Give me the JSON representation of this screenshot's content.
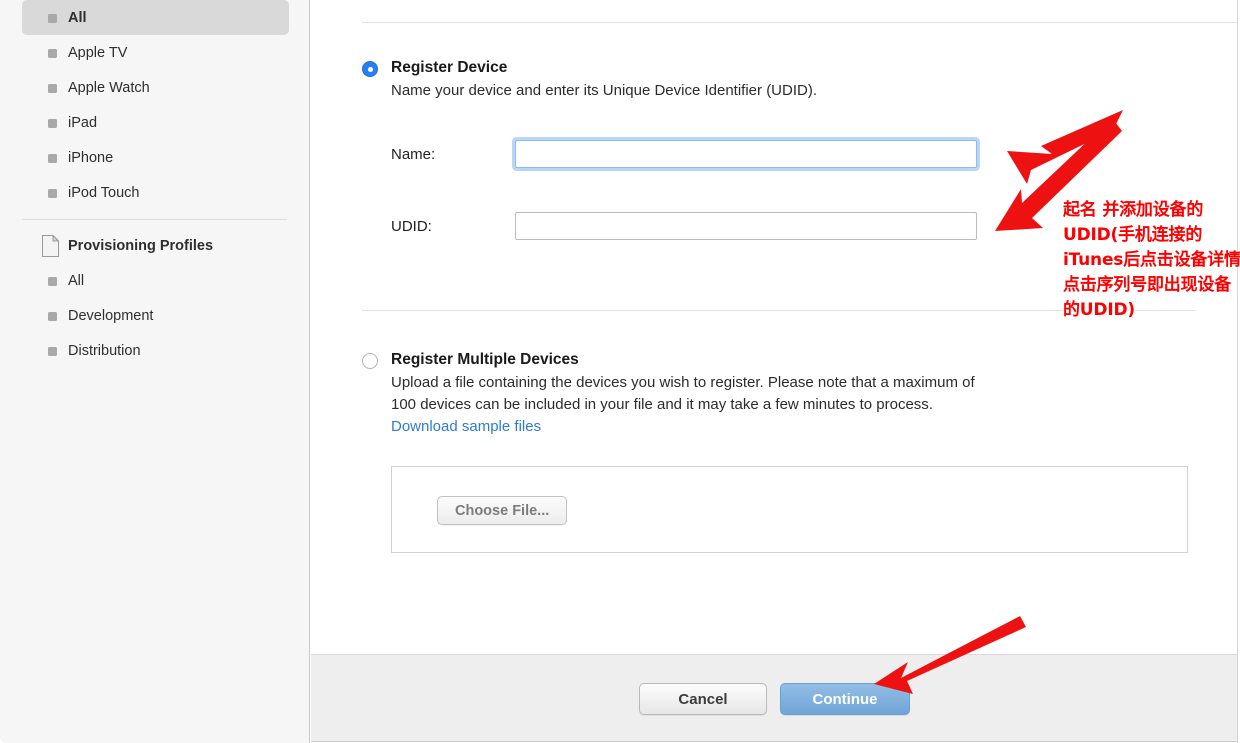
{
  "sidebar": {
    "devices": [
      {
        "label": "All",
        "selected": true
      },
      {
        "label": "Apple TV",
        "selected": false
      },
      {
        "label": "Apple Watch",
        "selected": false
      },
      {
        "label": "iPad",
        "selected": false
      },
      {
        "label": "iPhone",
        "selected": false
      },
      {
        "label": "iPod Touch",
        "selected": false
      }
    ],
    "profiles_header": "Provisioning Profiles",
    "profiles": [
      {
        "label": "All",
        "selected": false
      },
      {
        "label": "Development",
        "selected": false
      },
      {
        "label": "Distribution",
        "selected": false
      }
    ]
  },
  "register_device": {
    "title": "Register Device",
    "description": "Name your device and enter its Unique Device Identifier (UDID).",
    "name_label": "Name:",
    "name_value": "",
    "name_placeholder": "",
    "udid_label": "UDID:",
    "udid_value": "",
    "udid_placeholder": "",
    "selected": true
  },
  "register_multiple": {
    "title": "Register Multiple Devices",
    "description_line1": "Upload a file containing the devices you wish to register. Please note that a maximum of",
    "description_line2": "100 devices can be included in your file and it may take a few minutes to process.",
    "download_link": "Download sample files",
    "choose_file_label": "Choose File...",
    "selected": false
  },
  "footer": {
    "cancel_label": "Cancel",
    "continue_label": "Continue"
  },
  "annotations": {
    "chinese_note": "起名 并添加设备的UDID(手机连接的iTunes后点击设备详情点击序列号即出现设备的UDID)",
    "note_color": "#ff0000",
    "arrow_color": "#ee1111"
  }
}
